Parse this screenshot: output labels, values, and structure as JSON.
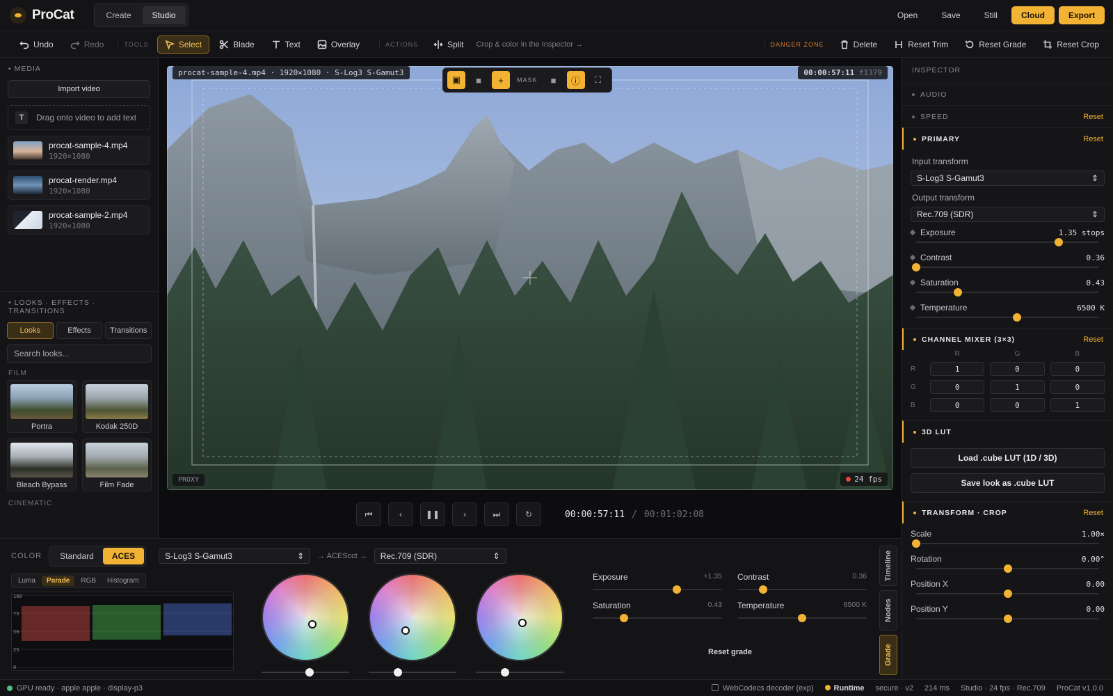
{
  "app": {
    "name": "ProCat",
    "version": "ProCat v1.0.0"
  },
  "topbar": {
    "modes": [
      "Create",
      "Studio"
    ],
    "active_mode": "Studio",
    "actions": [
      "Open",
      "Save",
      "Still"
    ],
    "cloud_label": "Cloud",
    "export_label": "Export"
  },
  "toolbar": {
    "undo": "Undo",
    "redo": "Redo",
    "tools_label": "TOOLS",
    "select": "Select",
    "blade": "Blade",
    "text": "Text",
    "overlay": "Overlay",
    "actions_label": "ACTIONS",
    "split": "Split",
    "hint": "Crop & color in the Inspector →",
    "danger_label": "DANGER ZONE",
    "delete": "Delete",
    "reset_trim": "Reset Trim",
    "reset_grade": "Reset Grade",
    "reset_crop": "Reset Crop"
  },
  "media": {
    "title": "MEDIA",
    "import_label": "Import video",
    "drop_text": "Drag onto video to add text",
    "drop_icon": "T",
    "items": [
      {
        "name": "procat-sample-4.mp4",
        "size": "1920×1080"
      },
      {
        "name": "procat-render.mp4",
        "size": "1920×1080"
      },
      {
        "name": "procat-sample-2.mp4",
        "size": "1920×1080"
      }
    ]
  },
  "looks_panel": {
    "title": "LOOKS · EFFECTS · TRANSITIONS",
    "tabs": [
      "Looks",
      "Effects",
      "Transitions"
    ],
    "active_tab": "Looks",
    "search_placeholder": "Search looks...",
    "film_label": "FILM",
    "film_looks": [
      "Portra",
      "Kodak 250D",
      "Bleach Bypass",
      "Film Fade"
    ],
    "cinematic_label": "CINEMATIC"
  },
  "viewer": {
    "file_badge": "procat-sample-4.mp4 · 1920×1080 · S-Log3 S-Gamut3",
    "timecode_badge": "00:00:57:11",
    "frame_badge": "f1379",
    "mask_label": "MASK",
    "proxy_label": "PROXY",
    "fps_label": "24 fps"
  },
  "transport": {
    "current": "00:00:57:11",
    "separator": "/",
    "duration": "00:01:02:08"
  },
  "inspector": {
    "title": "INSPECTOR",
    "audio": "AUDIO",
    "speed": "SPEED",
    "reset": "Reset",
    "primary": "PRIMARY",
    "input_transform_label": "Input transform",
    "input_transform": "S-Log3 S-Gamut3",
    "output_transform_label": "Output transform",
    "output_transform": "Rec.709 (SDR)",
    "sliders": [
      {
        "label": "Exposure",
        "value": "1.35 stops",
        "pos": 0.78
      },
      {
        "label": "Contrast",
        "value": "0.36",
        "pos": 0.0
      },
      {
        "label": "Saturation",
        "value": "0.43",
        "pos": 0.23
      },
      {
        "label": "Temperature",
        "value": "6500 K",
        "pos": 0.55
      }
    ],
    "channel_mixer": "CHANNEL MIXER (3×3)",
    "mixer_cols": [
      "R",
      "G",
      "B"
    ],
    "mixer_rows": [
      {
        "label": "R",
        "values": [
          "1",
          "0",
          "0"
        ]
      },
      {
        "label": "G",
        "values": [
          "0",
          "1",
          "0"
        ]
      },
      {
        "label": "B",
        "values": [
          "0",
          "0",
          "1"
        ]
      }
    ],
    "lut": "3D LUT",
    "load_lut": "Load .cube LUT (1D / 3D)",
    "save_lut": "Save look as .cube LUT",
    "transform": "TRANSFORM · CROP",
    "transform_sliders": [
      {
        "label": "Scale",
        "value": "1.00×",
        "pos": 0.0
      },
      {
        "label": "Rotation",
        "value": "0.00°",
        "pos": 0.5
      },
      {
        "label": "Position X",
        "value": "0.00",
        "pos": 0.5
      },
      {
        "label": "Position Y",
        "value": "0.00",
        "pos": 0.5
      }
    ]
  },
  "color": {
    "label": "COLOR",
    "modes": [
      "Standard",
      "ACES"
    ],
    "active_mode": "ACES",
    "input": "S-Log3 S-Gamut3",
    "aces_label": "→ ACEScct →",
    "output": "Rec.709 (SDR)",
    "scopes": [
      "Luma",
      "Parade",
      "RGB",
      "Histogram"
    ],
    "active_scope": "Parade",
    "scope_ticks": [
      "100",
      "75",
      "50",
      "25",
      "0"
    ],
    "wheels": [
      {
        "dot_x": 0.58,
        "dot_y": 0.58,
        "slider": 0.55
      },
      {
        "dot_x": 0.42,
        "dot_y": 0.65,
        "slider": 0.33
      },
      {
        "dot_x": 0.53,
        "dot_y": 0.56,
        "slider": 0.33
      }
    ],
    "grade_sliders": [
      {
        "label": "Exposure",
        "value": "+1.35",
        "pos": 0.65
      },
      {
        "label": "Contrast",
        "value": "0.36",
        "pos": 0.2
      },
      {
        "label": "Saturation",
        "value": "0.43",
        "pos": 0.24
      },
      {
        "label": "Temperature",
        "value": "6500 K",
        "pos": 0.5
      }
    ],
    "reset_grade": "Reset grade",
    "side_tabs": [
      "Timeline",
      "Nodes",
      "Grade"
    ],
    "active_side_tab": "Grade"
  },
  "status": {
    "left": "GPU ready · apple apple · display-p3",
    "decoder": "WebCodecs decoder (exp)",
    "runtime": "Runtime",
    "secure": "secure · v2",
    "ms": "214 ms",
    "studio": "Studio · 24 fps · Rec.709",
    "version": "ProCat v1.0.0"
  },
  "colors": {
    "accent": "#f2b233",
    "bg": "#111113",
    "ready": "#4cc07a"
  }
}
